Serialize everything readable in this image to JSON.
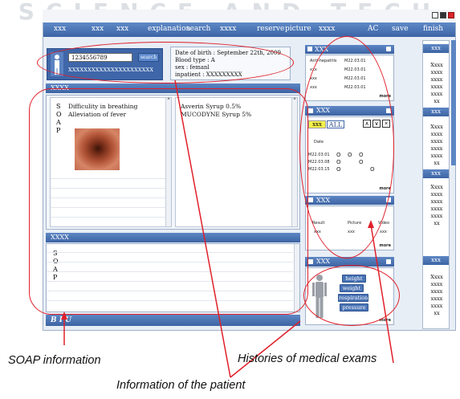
{
  "watermark": "SCIENCE AND TECH",
  "menu": {
    "left_items": [
      "xxx",
      "xxx",
      "xxx",
      "explanation",
      "search",
      "xxxx"
    ],
    "right_items": [
      "reserve",
      "picture",
      "xxxx",
      "AC",
      "save",
      "finish"
    ]
  },
  "patient": {
    "id": "1234556789",
    "search_label": "search",
    "name_placeholder": "XXXXXXXXXXXXXXXXXXXXXX",
    "dob": "Date of birth : September 22th, 2009",
    "blood": "Blood type  :  A",
    "sex": "sex      :   femanl",
    "inpatient": "inpatient : XXXXXXXXX"
  },
  "soap_upper": {
    "title": "XXXX",
    "letters": [
      "S",
      "O",
      "A",
      "P"
    ],
    "complaints": [
      "Difficulity in breathing",
      "Alleviation of fever"
    ],
    "prescriptions": [
      "Asverin Syrup 0.5%",
      "MUCODYNE Syrup 5%"
    ]
  },
  "soap_lower": {
    "title": "XXXX",
    "letters": [
      "S",
      "O",
      "A",
      "P"
    ]
  },
  "footer_tools": "B  I  U",
  "exam_panel_1": {
    "title": "XXX",
    "col_header": "Anti-hepatitis",
    "rows": [
      {
        "label": "Anti-hepatitis",
        "value": "M22.03.01"
      },
      {
        "label": "xxx",
        "value": "M22.03.01"
      },
      {
        "label": "xxx",
        "value": "M22.03.01"
      },
      {
        "label": "xxx",
        "value": "M22.03.01"
      }
    ],
    "more": "more"
  },
  "exam_panel_2": {
    "title": "XXX",
    "tab_active": "xxx",
    "tab_all": "ALL",
    "nav": [
      "∧",
      "∨",
      "×"
    ],
    "col_date": "Date",
    "dates": [
      "M22.03.01",
      "M22.03.08",
      "M22.03.15"
    ],
    "marks": [
      [
        "O",
        "O",
        "O",
        ""
      ],
      [
        "O",
        "",
        "O",
        ""
      ],
      [
        "O",
        "",
        "",
        "O"
      ]
    ],
    "more": "more"
  },
  "exam_panel_3": {
    "title": "XXX",
    "cols": [
      "Result",
      "Picture",
      "Video"
    ],
    "row": [
      "xxx",
      "xxx",
      "xxx"
    ],
    "more": "more"
  },
  "body_panel": {
    "title": "XXX",
    "buttons": [
      "height",
      "weight",
      "respiration",
      "pressure"
    ],
    "more": "more"
  },
  "sidebar": {
    "header": "xxx",
    "group1": [
      "Xxxx",
      "xxxx",
      "xxxx",
      "xxxx",
      "xxxx",
      "xx"
    ],
    "btn1": "xxx",
    "group2": [
      "Xxxx",
      "xxxx",
      "xxxx",
      "xxxx",
      "xxxx",
      "xx"
    ],
    "btn2": "xxx",
    "group3": [
      "Xxxx",
      "xxxx",
      "xxxx",
      "xxxx",
      "xxxx",
      "xx"
    ],
    "btn3": "xxx",
    "group4": [
      "Xxxx",
      "xxxx",
      "xxxx",
      "xxxx",
      "xxxx",
      "xx"
    ]
  },
  "annotations": {
    "soap": "SOAP information",
    "exams": "Histories of medical exams",
    "patient": "Information of the patient"
  }
}
